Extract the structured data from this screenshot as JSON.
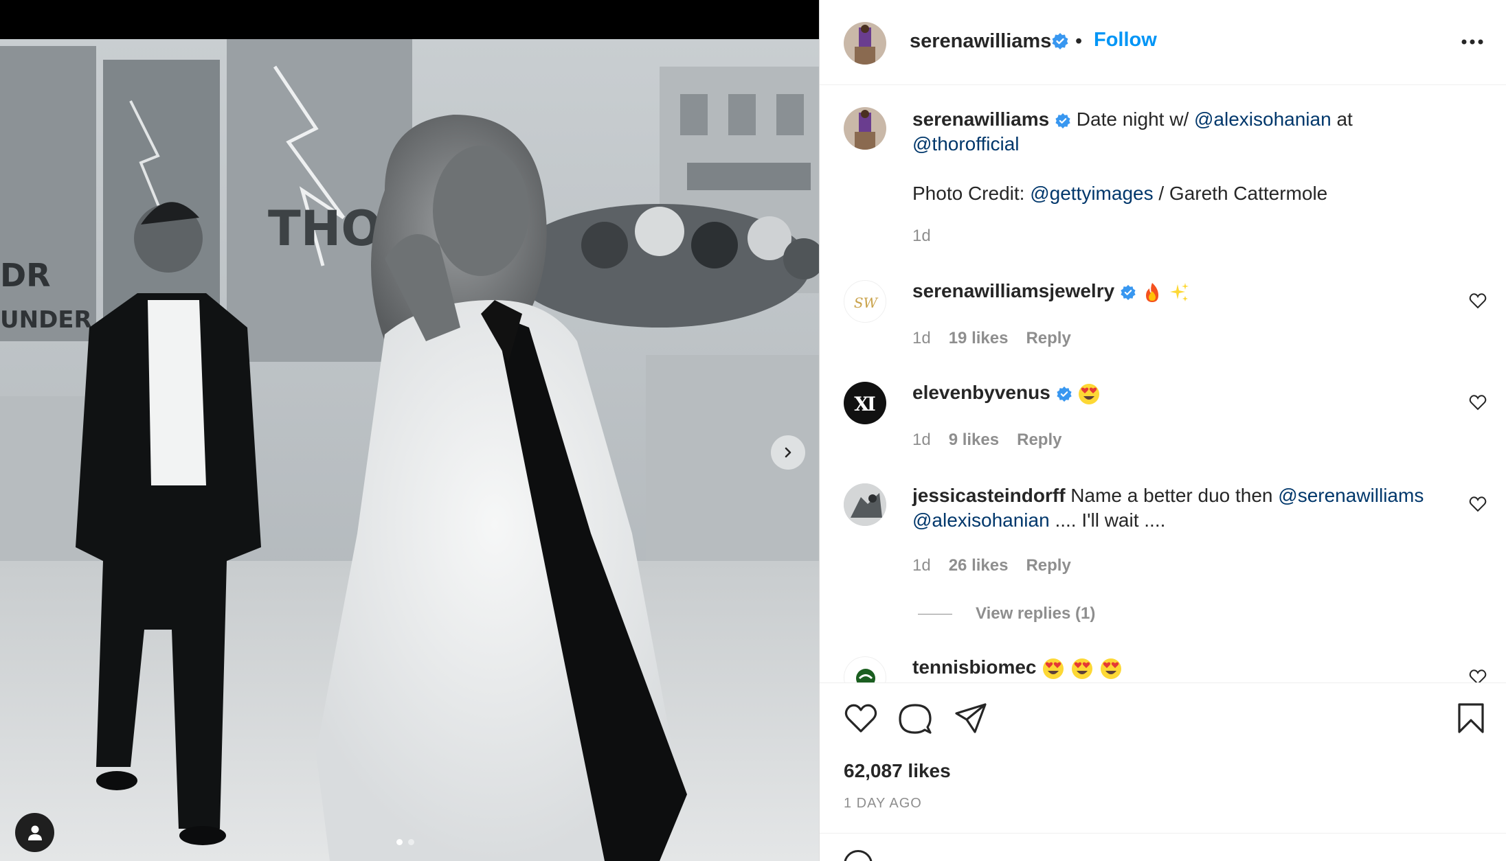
{
  "post": {
    "author": "serenawilliams",
    "follow_label": "Follow",
    "separator": "•",
    "caption": {
      "username": "serenawilliams",
      "text_1": "Date night w/ ",
      "mention_1": "@alexisohanian",
      "text_2": " at ",
      "mention_2": "@thorofficial",
      "credit_prefix": "Photo Credit: ",
      "credit_mention": "@gettyimages",
      "credit_suffix": " / Gareth Cattermole",
      "time": "1d"
    },
    "likes": "62,087 likes",
    "posted_ago": "1 DAY AGO"
  },
  "comments": [
    {
      "username": "serenawilliamsjewelry",
      "avatar_text": "SW",
      "emojis": [
        "fire",
        "sparkles"
      ],
      "time": "1d",
      "likes": "19 likes",
      "reply_label": "Reply"
    },
    {
      "username": "elevenbyvenus",
      "avatar_text": "Ⅺ",
      "emojis": [
        "heart-eyes"
      ],
      "time": "1d",
      "likes": "9 likes",
      "reply_label": "Reply"
    },
    {
      "username": "jessicasteindorff",
      "text_1": " Name a better duo then ",
      "mention_1": "@serenawilliams",
      "mention_2": "@alexisohanian",
      "text_2": " .... I'll wait ....",
      "time": "1d",
      "likes": "26 likes",
      "reply_label": "Reply",
      "view_replies": "View replies (1)"
    },
    {
      "username": "tennisbiomec",
      "emojis": [
        "heart-eyes",
        "heart-eyes",
        "heart-eyes"
      ]
    }
  ],
  "colors": {
    "follow": "#0095f6",
    "mention": "#00376b",
    "verified": "#3897f0",
    "muted": "#8e8e8e",
    "text": "#262626"
  },
  "icons": [
    "verified-badge",
    "more-options-icon",
    "heart-icon",
    "comment-icon",
    "share-icon",
    "bookmark-icon",
    "chevron-right-icon",
    "user-tag-icon",
    "fire-emoji",
    "sparkles-emoji",
    "heart-eyes-emoji"
  ]
}
